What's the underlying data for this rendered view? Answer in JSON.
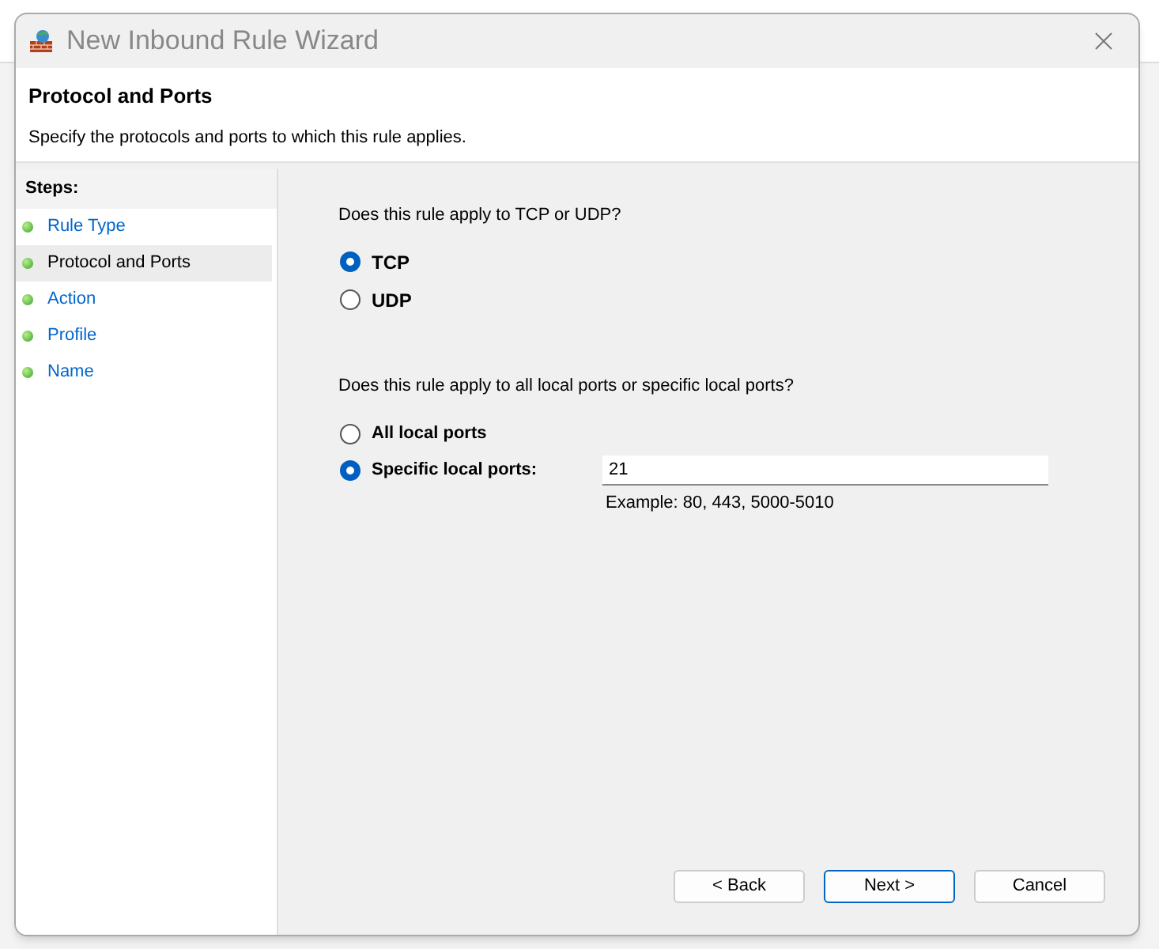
{
  "window": {
    "title": "New Inbound Rule Wizard"
  },
  "header": {
    "title": "Protocol and Ports",
    "subtitle": "Specify the protocols and ports to which this rule applies."
  },
  "steps": {
    "heading": "Steps:",
    "items": [
      {
        "label": "Rule Type",
        "selected": false
      },
      {
        "label": "Protocol and Ports",
        "selected": true
      },
      {
        "label": "Action",
        "selected": false
      },
      {
        "label": "Profile",
        "selected": false
      },
      {
        "label": "Name",
        "selected": false
      }
    ]
  },
  "protocol": {
    "question": "Does this rule apply to TCP or UDP?",
    "options": [
      {
        "label": "TCP",
        "selected": true
      },
      {
        "label": "UDP",
        "selected": false
      }
    ]
  },
  "ports": {
    "question": "Does this rule apply to all local ports or specific local ports?",
    "options": [
      {
        "label": "All local ports",
        "selected": false
      },
      {
        "label": "Specific local ports:",
        "selected": true
      }
    ],
    "value": "21",
    "example": "Example: 80, 443, 5000-5010"
  },
  "buttons": [
    {
      "label": "< Back",
      "default": false
    },
    {
      "label": "Next >",
      "default": true
    },
    {
      "label": "Cancel",
      "default": false
    }
  ]
}
